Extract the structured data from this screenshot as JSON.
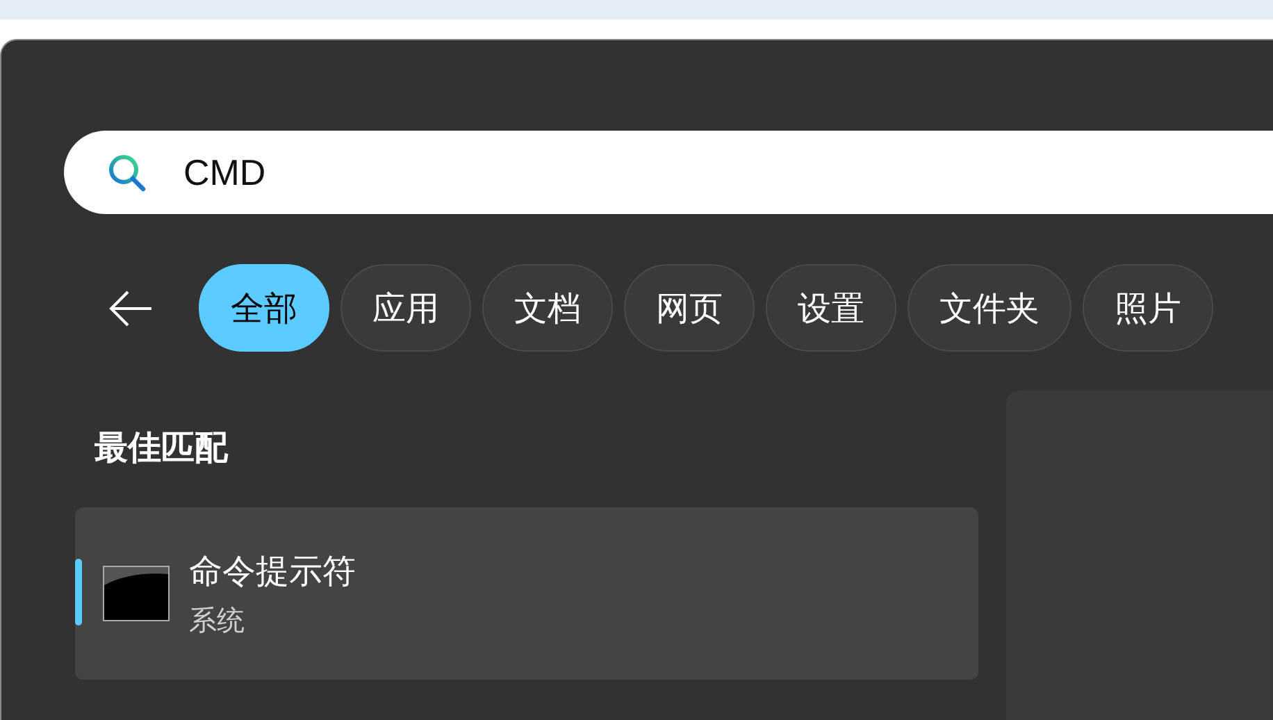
{
  "search": {
    "value": "CMD"
  },
  "filters": [
    {
      "label": "全部",
      "selected": true
    },
    {
      "label": "应用",
      "selected": false
    },
    {
      "label": "文档",
      "selected": false
    },
    {
      "label": "网页",
      "selected": false
    },
    {
      "label": "设置",
      "selected": false
    },
    {
      "label": "文件夹",
      "selected": false
    },
    {
      "label": "照片",
      "selected": false
    }
  ],
  "best_match": {
    "heading": "最佳匹配",
    "result": {
      "title": "命令提示符",
      "subtitle": "系统",
      "selected": true
    }
  }
}
